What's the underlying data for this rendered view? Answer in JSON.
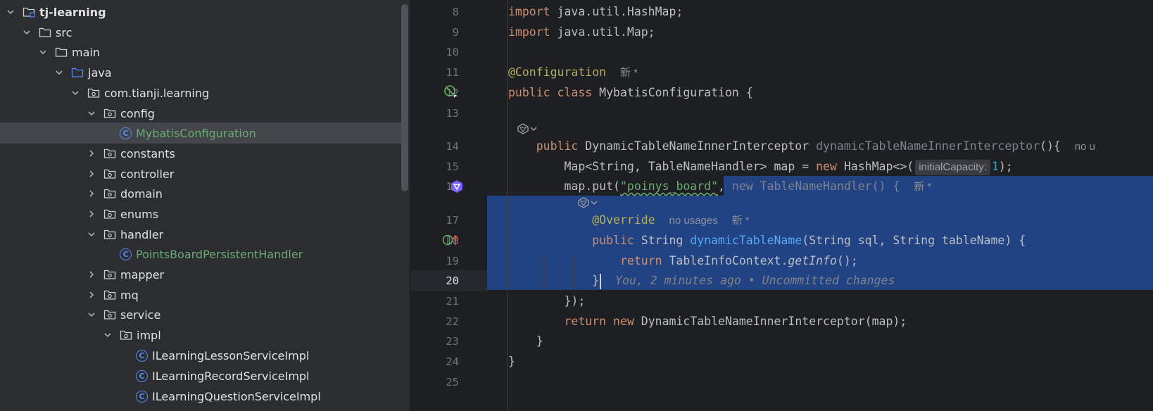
{
  "project_tree": {
    "items": [
      {
        "label": "tj-learning",
        "type": "module",
        "expanded": true,
        "bold": true
      },
      {
        "label": "src",
        "type": "folder",
        "expanded": true
      },
      {
        "label": "main",
        "type": "folder",
        "expanded": true
      },
      {
        "label": "java",
        "type": "source-folder",
        "expanded": true
      },
      {
        "label": "com.tianji.learning",
        "type": "package",
        "expanded": true
      },
      {
        "label": "config",
        "type": "package",
        "expanded": true
      },
      {
        "label": "MybatisConfiguration",
        "type": "class",
        "selected": true
      },
      {
        "label": "constants",
        "type": "package",
        "expanded": false
      },
      {
        "label": "controller",
        "type": "package",
        "expanded": false
      },
      {
        "label": "domain",
        "type": "package",
        "expanded": false
      },
      {
        "label": "enums",
        "type": "package",
        "expanded": false
      },
      {
        "label": "handler",
        "type": "package",
        "expanded": true
      },
      {
        "label": "PointsBoardPersistentHandler",
        "type": "class"
      },
      {
        "label": "mapper",
        "type": "package",
        "expanded": false
      },
      {
        "label": "mq",
        "type": "package",
        "expanded": false
      },
      {
        "label": "service",
        "type": "package",
        "expanded": true
      },
      {
        "label": "impl",
        "type": "package",
        "expanded": true
      },
      {
        "label": "ILearningLessonServiceImpl",
        "type": "class"
      },
      {
        "label": "ILearningRecordServiceImpl",
        "type": "class"
      },
      {
        "label": "ILearningQuestionServiceImpl",
        "type": "class"
      }
    ]
  },
  "editor": {
    "line_numbers": [
      "8",
      "9",
      "10",
      "11",
      "12",
      "13",
      "14",
      "15",
      "16",
      "17",
      "18",
      "19",
      "20",
      "21",
      "22",
      "23",
      "24",
      "25"
    ],
    "current_line": "20",
    "code": {
      "l8": {
        "kw": "import",
        "rest": " java.util.HashMap;"
      },
      "l9": {
        "kw": "import",
        "rest": " java.util.Map;"
      },
      "l11": {
        "ann": "@Configuration",
        "badge": "新 *"
      },
      "l12": {
        "kw1": "public",
        "kw2": "class",
        "rest": " MybatisConfiguration {"
      },
      "l14": {
        "kw": "public",
        "type": " DynamicTableNameInnerInterceptor ",
        "name": "dynamicTableNameInnerInterceptor",
        "rest": "(){",
        "usage": "no u"
      },
      "l15": {
        "a": "Map<String, TableNameHandler> map = ",
        "kw": "new",
        "b": " HashMap<>(",
        "hint": "initialCapacity:",
        "num": "1",
        "c": ");"
      },
      "l16": {
        "a": "map.put(",
        "str": "\"poinys_board\"",
        "b": ", ",
        "kw": "new",
        "c": " TableNameHandler() {",
        "badge": "新 *"
      },
      "l17": {
        "ann": "@Override",
        "usage": "no usages",
        "badge": "新 *"
      },
      "l18": {
        "kw": "public",
        "a": " String ",
        "fn": "dynamicTableName",
        "b": "(String sql, String tableName) {"
      },
      "l19": {
        "kw": "return",
        "a": " TableInfoContext.",
        "it": "getInfo",
        "b": "();"
      },
      "l20": {
        "a": "}",
        "blame": "You, 2 minutes ago • Uncommitted changes"
      },
      "l21": {
        "a": "});"
      },
      "l22": {
        "kw1": "return",
        "kw2": "new",
        "a": " DynamicTableNameInnerInterceptor(map);"
      },
      "l23": {
        "a": "}"
      },
      "l24": {
        "a": "}"
      }
    }
  },
  "colors": {
    "accent": "#548af7",
    "selection": "#214283",
    "keyword": "#cf8e6d",
    "annotation": "#b3ae60",
    "string": "#6aab73"
  }
}
